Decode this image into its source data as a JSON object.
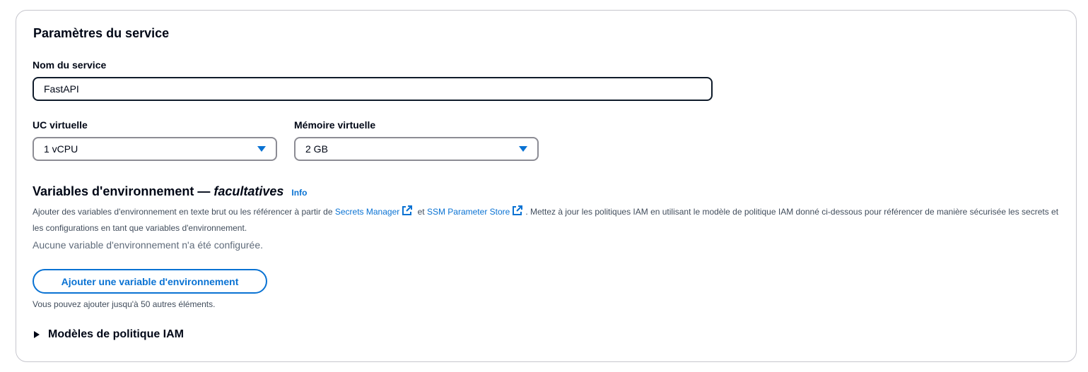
{
  "service_settings": {
    "title": "Paramètres du service",
    "service_name_label": "Nom du service",
    "service_name_value": "FastAPI",
    "vcpu_label": "UC virtuelle",
    "vcpu_value": "1 vCPU",
    "memory_label": "Mémoire virtuelle",
    "memory_value": "2 GB"
  },
  "env_vars": {
    "title_main": "Variables d'environnement — ",
    "title_optional": "facultatives",
    "info_link": "Info",
    "desc_part1": "Ajouter des variables d'environnement en texte brut ou les référencer à partir de ",
    "secrets_manager_link": "Secrets Manager",
    "desc_and": " et ",
    "ssm_link": "SSM Parameter Store",
    "desc_part2": ". Mettez à jour les politiques IAM en utilisant le modèle de politique IAM donné ci-dessous pour référencer de manière sécurisée les secrets et les configurations en tant que variables d'environnement.",
    "empty_message": "Aucune variable d'environnement n'a été configurée.",
    "add_button": "Ajouter une variable d'environnement",
    "limit_hint": "Vous pouvez ajouter jusqu'à 50 autres éléments."
  },
  "iam_policy": {
    "expander_label": "Modèles de politique IAM"
  },
  "icons": {
    "external_link": "external-link-icon",
    "caret": "caret-down-icon",
    "expand": "caret-right-icon"
  },
  "colors": {
    "link": "#0972d3",
    "text": "#000716",
    "muted": "#414d5c",
    "border": "#c6c6cd"
  }
}
